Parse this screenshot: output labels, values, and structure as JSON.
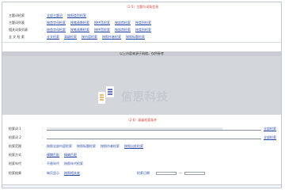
{
  "section1": {
    "title": "（1-5）主题与词条信息",
    "rows": [
      {
        "label": "主题词检索",
        "links": [
          "全部主题词",
          "按照类别检索"
        ]
      },
      {
        "label": "主题词列表",
        "links": [
          "按首字母检索",
          "按笔画数检索",
          "按拼音检索",
          "按部首检索",
          "按类别检索"
        ]
      },
      {
        "label": "相关词条列表",
        "links": [
          "按首字母检索",
          "按笔画数检索",
          "按拼音检索",
          "按部首检索",
          "按类别检索"
        ]
      },
      {
        "label": "全 文 检 索",
        "links": [
          "全文检索",
          "高级检索",
          "按内容检索",
          "按照作者检索",
          "按照标题检索"
        ]
      }
    ]
  },
  "banner": {
    "caption": "以上内容来源于网络，仅供参考",
    "logo_text": "信思科技"
  },
  "section2": {
    "title": "（2-6）高级检索条件",
    "rows": [
      {
        "label": "检索词 1",
        "link": "全部检索",
        "fill": 0.82
      },
      {
        "label": "检索词 2",
        "link": "全部检索",
        "fill": 0.0
      },
      {
        "label": "检索范围",
        "links": [
          "按照全部内容检索",
          "按照标题检索",
          "按照作者检索"
        ],
        "extra": "按照出处检索"
      },
      {
        "label": "检索方式",
        "links": [
          "模糊匹配",
          "精确匹配"
        ]
      },
      {
        "label": "检索年代",
        "links": [
          "不限年代",
          "按照年代检索"
        ]
      },
      {
        "label": "检索结果",
        "links": [
          "每页显示",
          "按照相关度"
        ],
        "date_label": "检索日期"
      }
    ]
  },
  "colors": {
    "accent_red": "#d8392b",
    "link_blue": "#2a4aa8",
    "banner_gray": "#d3d6db"
  }
}
